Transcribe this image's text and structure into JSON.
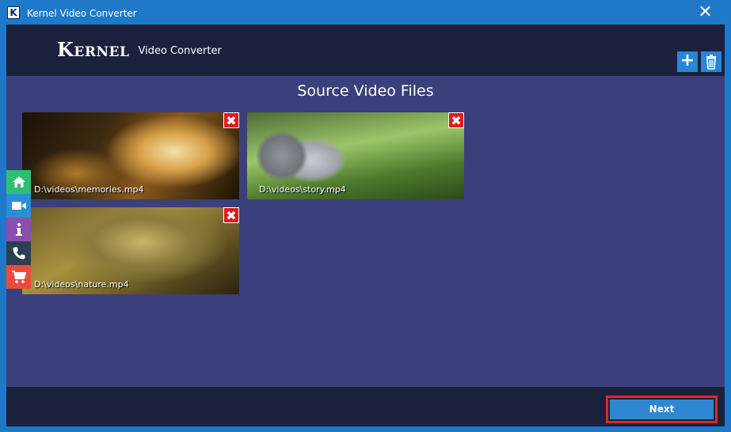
{
  "window": {
    "app_icon_letter": "K",
    "title": "Kernel Video Converter",
    "close_glyph": "✕"
  },
  "header": {
    "brand_name": "Kernel",
    "brand_sub": "Video Converter",
    "add_glyph": "+",
    "add_icon": "plus-icon",
    "delete_icon": "trash-icon"
  },
  "main": {
    "section_title": "Source Video Files",
    "files": [
      {
        "path": "D:\\videos\\memories.mp4",
        "remove_glyph": "✖"
      },
      {
        "path": "D:\\videos\\story.mp4",
        "remove_glyph": "✖"
      },
      {
        "path": "D:\\videos\\nature.mp4",
        "remove_glyph": "✖"
      }
    ]
  },
  "sidebar": {
    "items": [
      {
        "icon": "home-icon",
        "color": "#2fbf71"
      },
      {
        "icon": "video-camera-icon",
        "color": "#2a8fd6"
      },
      {
        "icon": "info-icon",
        "color": "#8a4fb0"
      },
      {
        "icon": "phone-icon",
        "color": "#2c3e50"
      },
      {
        "icon": "cart-icon",
        "color": "#e74c3c"
      }
    ]
  },
  "footer": {
    "next_label": "Next"
  },
  "colors": {
    "titlebar": "#1f78c8",
    "header_bg": "#1b213d",
    "content_bg": "#3b3f7c",
    "accent_blue": "#2f86d3",
    "remove_red": "#e21a1a",
    "highlight_red": "#e0262b"
  }
}
